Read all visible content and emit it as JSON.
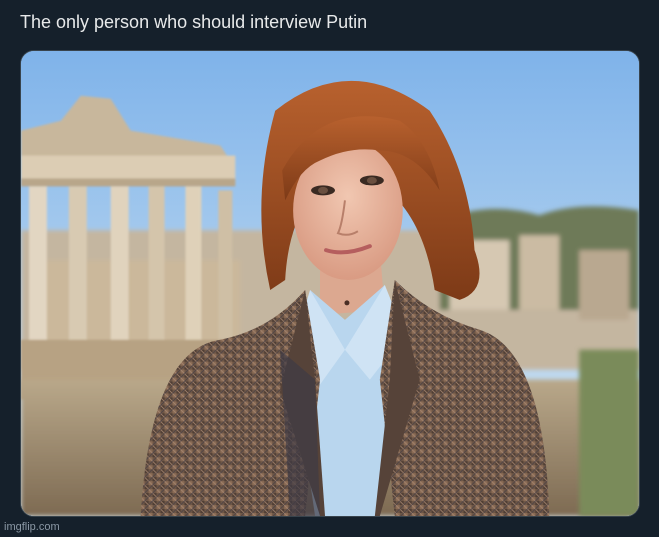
{
  "post": {
    "text": "The only person who should interview Putin"
  },
  "media": {
    "alt": "Woman with auburn bangs and ponytail, wearing a houndstooth tweed blazer and light blue shirt, standing in front of Roman ruins"
  },
  "watermark": {
    "text": "imgflip.com"
  },
  "colors": {
    "background": "#15202b",
    "text": "#e7e9ea",
    "muted": "#8b98a5",
    "border": "#38444d"
  }
}
